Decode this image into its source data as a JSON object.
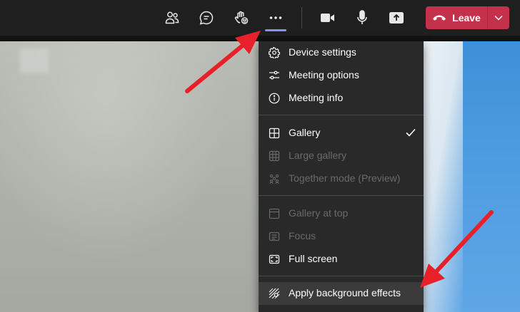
{
  "toolbar": {
    "buttons": [
      {
        "name": "participants",
        "icon": "people-icon"
      },
      {
        "name": "chat",
        "icon": "chat-icon"
      },
      {
        "name": "reactions",
        "icon": "raise-hand-icon"
      },
      {
        "name": "more-actions",
        "icon": "more-icon",
        "active": true
      },
      {
        "name": "camera",
        "icon": "camera-icon"
      },
      {
        "name": "mic",
        "icon": "mic-icon"
      },
      {
        "name": "share",
        "icon": "share-tray-icon"
      }
    ],
    "leave_label": "Leave",
    "colors": {
      "bar": "#1f1f1f",
      "leave": "#c4314b",
      "active_underline": "#8b8cf5"
    }
  },
  "menu": {
    "items": [
      {
        "label": "Device settings",
        "icon": "gear-icon",
        "enabled": true
      },
      {
        "label": "Meeting options",
        "icon": "sliders-icon",
        "enabled": true
      },
      {
        "label": "Meeting info",
        "icon": "info-icon",
        "enabled": true
      },
      {
        "label": "Gallery",
        "icon": "gallery-icon",
        "enabled": true,
        "checked": true
      },
      {
        "label": "Large gallery",
        "icon": "large-gallery-icon",
        "enabled": false
      },
      {
        "label": "Together mode (Preview)",
        "icon": "together-mode-icon",
        "enabled": false
      },
      {
        "label": "Gallery at top",
        "icon": "gallery-at-top-icon",
        "enabled": false
      },
      {
        "label": "Focus",
        "icon": "focus-icon",
        "enabled": false
      },
      {
        "label": "Full screen",
        "icon": "full-screen-icon",
        "enabled": true
      },
      {
        "label": "Apply background effects",
        "icon": "background-effects-icon",
        "enabled": true,
        "highlighted": true
      }
    ],
    "colors": {
      "background": "#292929",
      "text": "#ffffff",
      "disabled_text": "#6a6a6a"
    }
  },
  "annotations": {
    "arrow_color": "#e8202a"
  }
}
